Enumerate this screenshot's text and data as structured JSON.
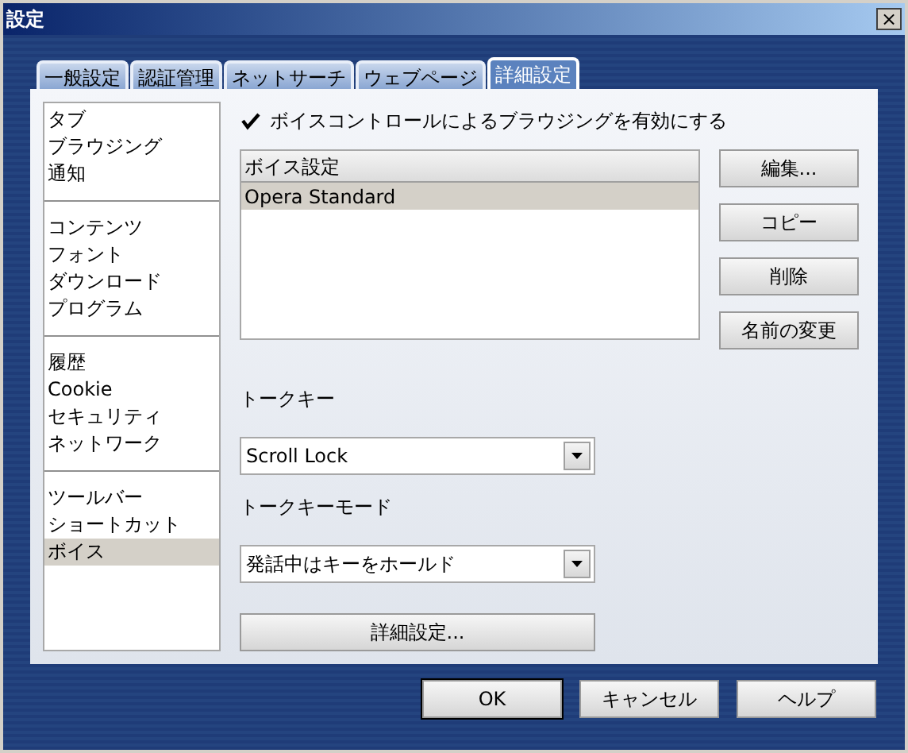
{
  "window": {
    "title": "設定",
    "close": "×"
  },
  "tabs": [
    {
      "label": "一般設定",
      "selected": false
    },
    {
      "label": "認証管理",
      "selected": false
    },
    {
      "label": "ネットサーチ",
      "selected": false
    },
    {
      "label": "ウェブページ",
      "selected": false
    },
    {
      "label": "詳細設定",
      "selected": true
    }
  ],
  "sidebar": {
    "groups": [
      {
        "items": [
          {
            "label": "タブ",
            "selected": false
          },
          {
            "label": "ブラウジング",
            "selected": false
          },
          {
            "label": "通知",
            "selected": false
          }
        ]
      },
      {
        "items": [
          {
            "label": "コンテンツ",
            "selected": false
          },
          {
            "label": "フォント",
            "selected": false
          },
          {
            "label": "ダウンロード",
            "selected": false
          },
          {
            "label": "プログラム",
            "selected": false
          }
        ]
      },
      {
        "items": [
          {
            "label": "履歴",
            "selected": false
          },
          {
            "label": "Cookie",
            "selected": false
          },
          {
            "label": "セキュリティ",
            "selected": false
          },
          {
            "label": "ネットワーク",
            "selected": false
          }
        ]
      },
      {
        "items": [
          {
            "label": "ツールバー",
            "selected": false
          },
          {
            "label": "ショートカット",
            "selected": false
          },
          {
            "label": "ボイス",
            "selected": true
          }
        ]
      }
    ]
  },
  "voice_checkbox": {
    "label": "ボイスコントロールによるブラウジングを有効にする",
    "checked": true
  },
  "voice_list": {
    "column": "ボイス設定",
    "rows": [
      {
        "label": "Opera Standard",
        "selected": true
      }
    ]
  },
  "list_buttons": [
    "編集...",
    "コピー",
    "削除",
    "名前の変更"
  ],
  "talk_key": {
    "label": "トークキー",
    "value": "Scroll Lock"
  },
  "talk_key_mode": {
    "label": "トークキーモード",
    "value": "発話中はキーをホールド"
  },
  "advanced_button": "詳細設定...",
  "footer_buttons": [
    {
      "label": "OK",
      "default": true
    },
    {
      "label": "キャンセル",
      "default": false
    },
    {
      "label": "ヘルプ",
      "default": false
    }
  ]
}
